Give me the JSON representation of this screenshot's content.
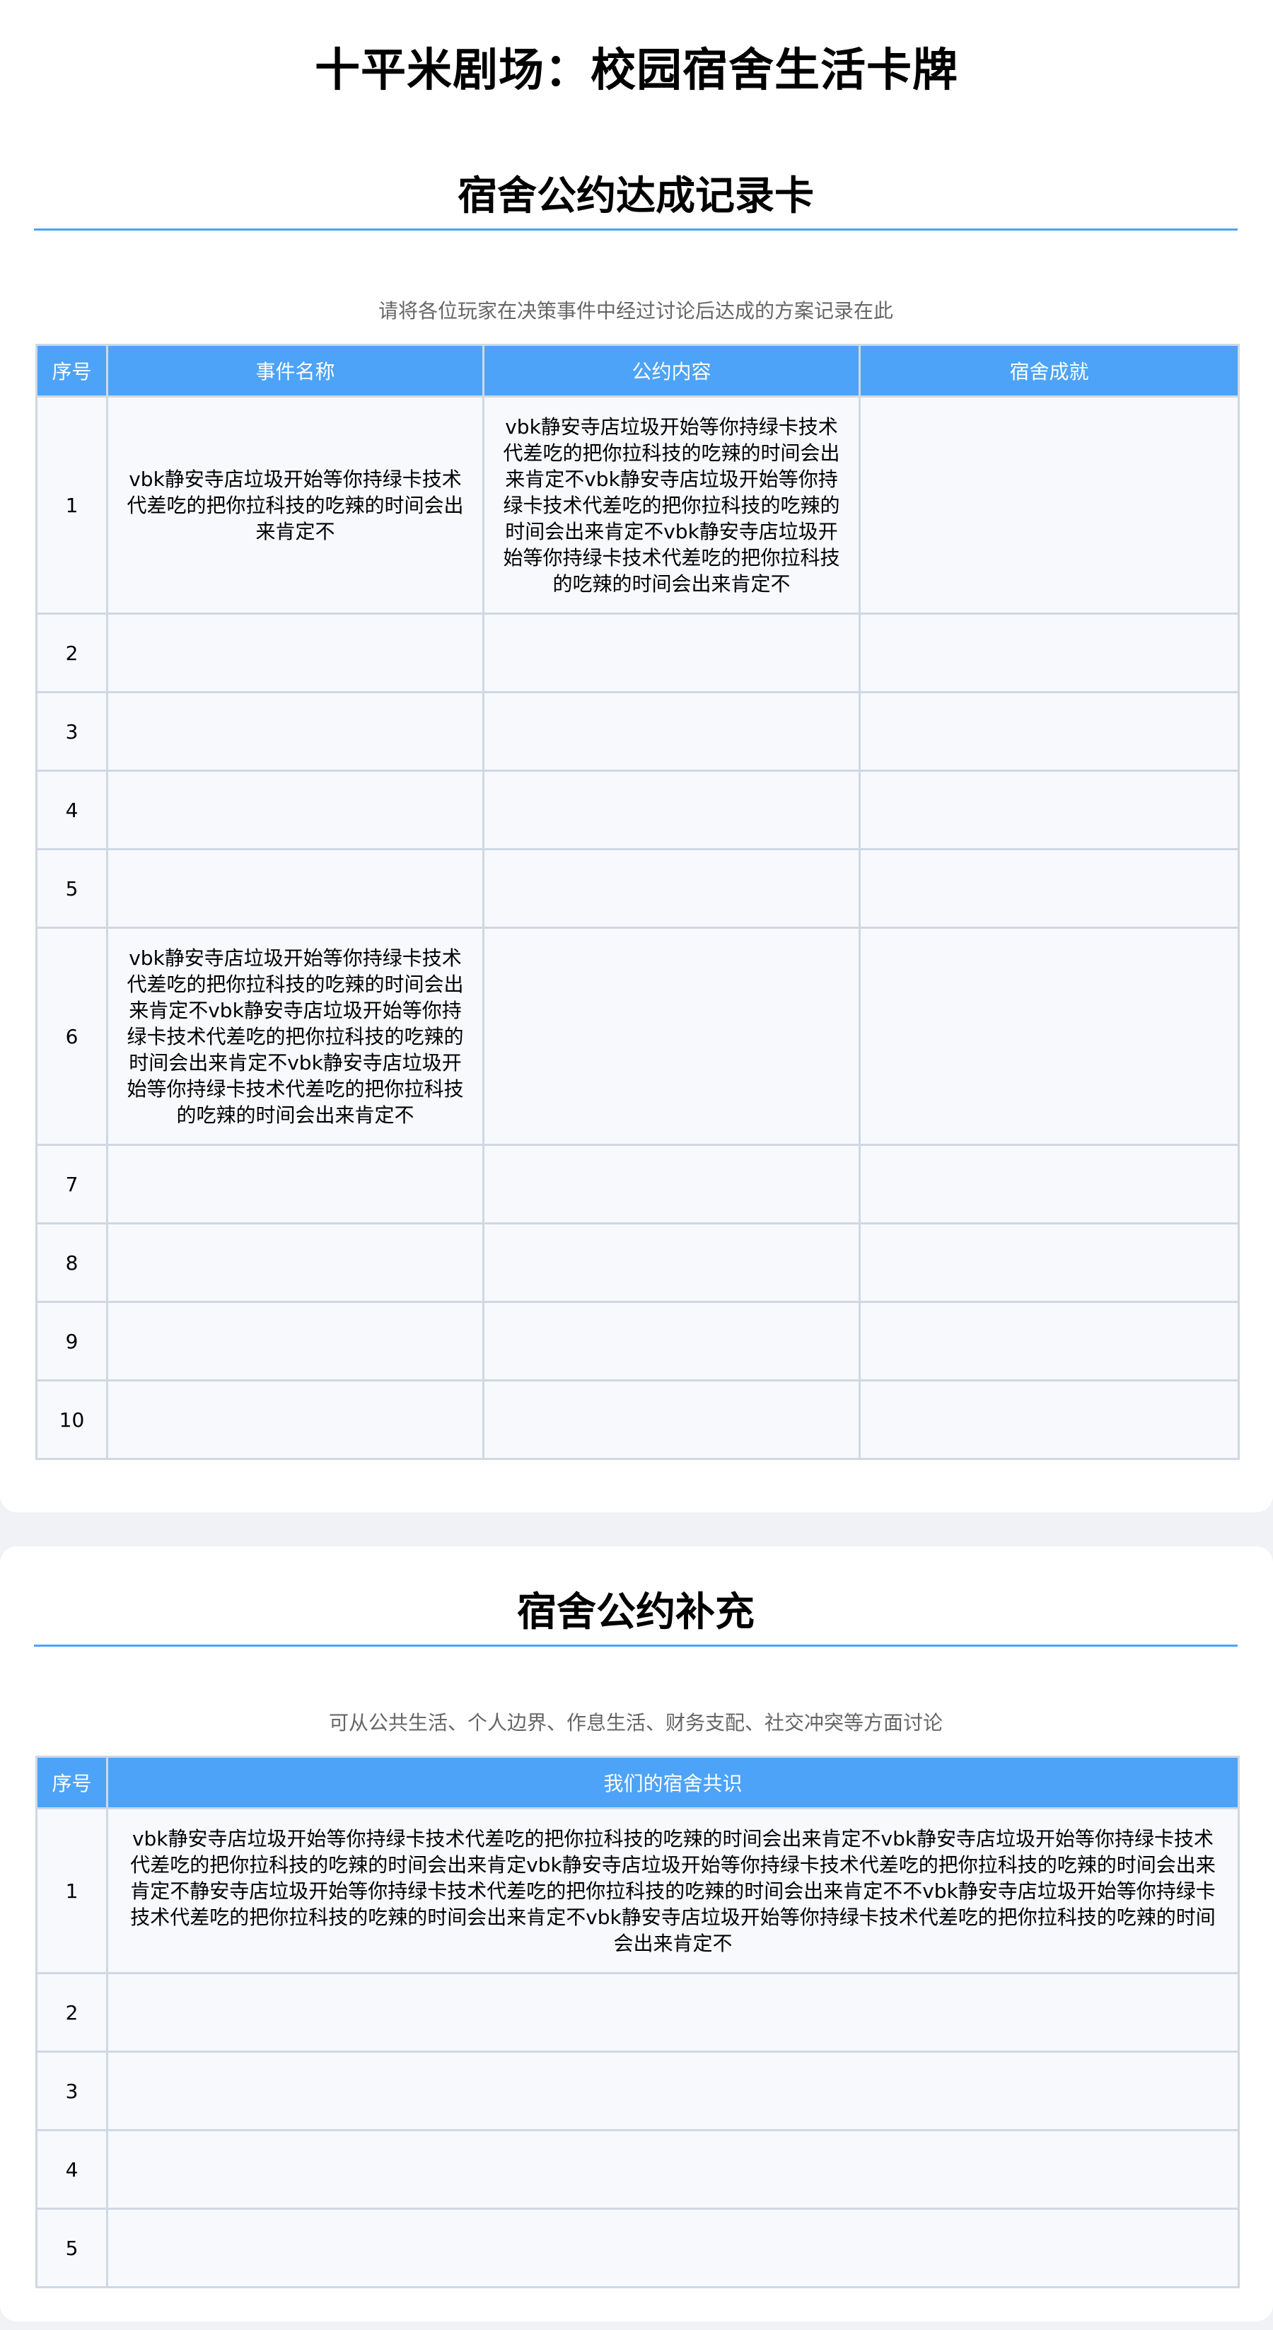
{
  "title": "十平米剧场：校园宿舍生活卡牌",
  "card1": {
    "heading": "宿舍公约达成记录卡",
    "hint": "请将各位玩家在决策事件中经过讨论后达成的方案记录在此",
    "columns": [
      "序号",
      "事件名称",
      "公约内容",
      "宿舍成就"
    ],
    "rows": [
      {
        "index": "1",
        "event": "vbk静安寺店垃圾开始等你持绿卡技术代差吃的把你拉科技的吃辣的时间会出来肯定不",
        "content": "vbk静安寺店垃圾开始等你持绿卡技术代差吃的把你拉科技的吃辣的时间会出来肯定不vbk静安寺店垃圾开始等你持绿卡技术代差吃的把你拉科技的吃辣的时间会出来肯定不vbk静安寺店垃圾开始等你持绿卡技术代差吃的把你拉科技的吃辣的时间会出来肯定不",
        "achievement": ""
      },
      {
        "index": "2",
        "event": "",
        "content": "",
        "achievement": ""
      },
      {
        "index": "3",
        "event": "",
        "content": "",
        "achievement": ""
      },
      {
        "index": "4",
        "event": "",
        "content": "",
        "achievement": ""
      },
      {
        "index": "5",
        "event": "",
        "content": "",
        "achievement": ""
      },
      {
        "index": "6",
        "event": "vbk静安寺店垃圾开始等你持绿卡技术代差吃的把你拉科技的吃辣的时间会出来肯定不vbk静安寺店垃圾开始等你持绿卡技术代差吃的把你拉科技的吃辣的时间会出来肯定不vbk静安寺店垃圾开始等你持绿卡技术代差吃的把你拉科技的吃辣的时间会出来肯定不",
        "content": "",
        "achievement": ""
      },
      {
        "index": "7",
        "event": "",
        "content": "",
        "achievement": ""
      },
      {
        "index": "8",
        "event": "",
        "content": "",
        "achievement": ""
      },
      {
        "index": "9",
        "event": "",
        "content": "",
        "achievement": ""
      },
      {
        "index": "10",
        "event": "",
        "content": "",
        "achievement": ""
      }
    ]
  },
  "card2": {
    "heading": "宿舍公约补充",
    "hint": "可从公共生活、个人边界、作息生活、财务支配、社交冲突等方面讨论",
    "columns": [
      "序号",
      "我们的宿舍共识"
    ],
    "rows": [
      {
        "index": "1",
        "consensus": "vbk静安寺店垃圾开始等你持绿卡技术代差吃的把你拉科技的吃辣的时间会出来肯定不vbk静安寺店垃圾开始等你持绿卡技术代差吃的把你拉科技的吃辣的时间会出来肯定vbk静安寺店垃圾开始等你持绿卡技术代差吃的把你拉科技的吃辣的时间会出来肯定不静安寺店垃圾开始等你持绿卡技术代差吃的把你拉科技的吃辣的时间会出来肯定不不vbk静安寺店垃圾开始等你持绿卡技术代差吃的把你拉科技的吃辣的时间会出来肯定不vbk静安寺店垃圾开始等你持绿卡技术代差吃的把你拉科技的吃辣的时间会出来肯定不"
      },
      {
        "index": "2",
        "consensus": ""
      },
      {
        "index": "3",
        "consensus": ""
      },
      {
        "index": "4",
        "consensus": ""
      },
      {
        "index": "5",
        "consensus": ""
      }
    ]
  }
}
